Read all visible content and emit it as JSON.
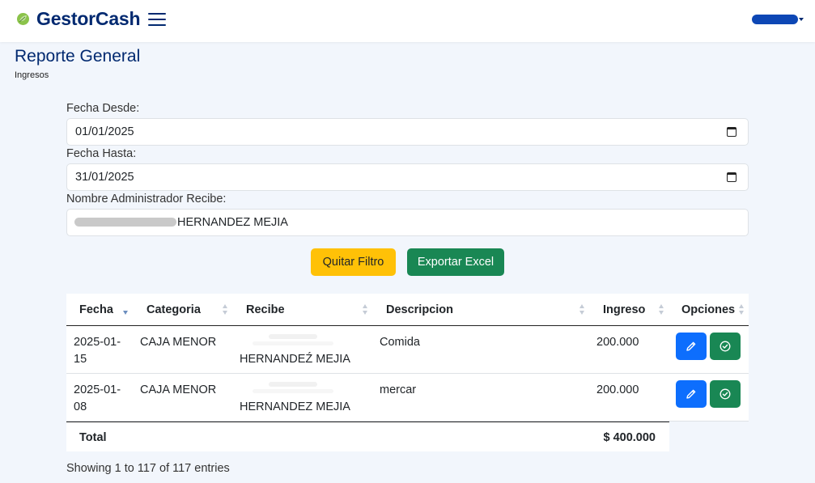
{
  "app": {
    "brand": "GestorCash",
    "brand_color": "#012970"
  },
  "page": {
    "title": "Reporte General",
    "subtitle": "Ingresos"
  },
  "filters": {
    "fecha_desde_label": "Fecha Desde:",
    "fecha_desde_value": "01/01/2025",
    "fecha_hasta_label": "Fecha Hasta:",
    "fecha_hasta_value": "31/01/2025",
    "admin_label": "Nombre Administrador Recibe:",
    "admin_value": "HERNANDEZ MEJIA"
  },
  "actions": {
    "clear_filter": "Quitar Filtro",
    "export_excel": "Exportar Excel"
  },
  "table": {
    "columns": [
      "Fecha",
      "Categoria",
      "Recibe",
      "Descripcion",
      "Ingreso",
      "Opciones"
    ],
    "sorted_column": "Fecha",
    "sort_direction": "desc",
    "rows": [
      {
        "fecha": "2025-01-15",
        "categoria": "CAJA MENOR",
        "recibe": "HERNANDEŹ MEJIA",
        "descripcion": "Comida",
        "ingreso": "200.000"
      },
      {
        "fecha": "2025-01-08",
        "categoria": "CAJA MENOR",
        "recibe": "HERNANDEZ MEJIA",
        "descripcion": "mercar",
        "ingreso": "200.000"
      }
    ],
    "total_label": "Total",
    "total_value": "$ 400.000"
  },
  "pagination": {
    "info": "Showing 1 to 117 of 117 entries"
  },
  "colors": {
    "primary": "#0d6efd",
    "success": "#198754",
    "warning": "#ffc107",
    "background": "#f2f6fc"
  },
  "icons": {
    "logo": "leaf-logo-icon",
    "menu": "hamburger-icon",
    "calendar": "calendar-icon",
    "edit": "pencil-icon",
    "confirm": "check-circle-icon"
  }
}
